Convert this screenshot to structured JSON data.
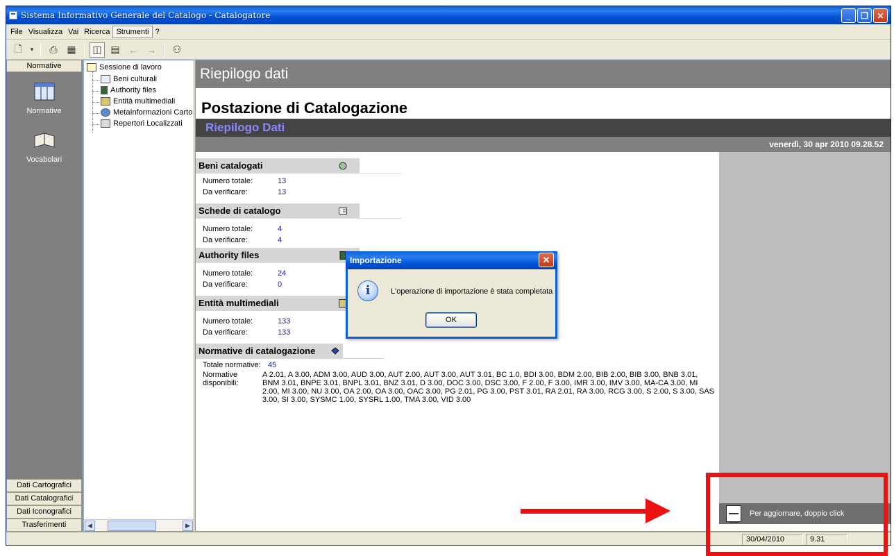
{
  "window": {
    "title": "Sistema Informativo Generale del Catalogo - Catalogatore"
  },
  "menu": {
    "items": [
      {
        "label": "File"
      },
      {
        "label": "Visualizza"
      },
      {
        "label": "Vai"
      },
      {
        "label": "Ricerca"
      },
      {
        "label": "Strumenti"
      },
      {
        "label": "?"
      }
    ]
  },
  "left_pane": {
    "header": "Normative",
    "items": [
      {
        "label": "Normative",
        "icon": "normative-icon"
      },
      {
        "label": "Vocabolari",
        "icon": "book-icon"
      }
    ],
    "bottom_buttons": [
      {
        "label": "Dati Cartografici"
      },
      {
        "label": "Dati Catalografici"
      },
      {
        "label": "Dati Iconografici"
      },
      {
        "label": "Trasferimenti"
      }
    ]
  },
  "tree": {
    "root": "Sessione di lavoro",
    "children": [
      {
        "label": "Beni culturali"
      },
      {
        "label": "Authority files"
      },
      {
        "label": "Entità multimediali"
      },
      {
        "label": "MetaInformazioni Carto"
      },
      {
        "label": "Repertori Localizzati"
      }
    ]
  },
  "content": {
    "header": "Riepilogo dati",
    "title": "Postazione di Catalogazione",
    "subtitle": "Riepilogo Dati",
    "date": "venerdì, 30 apr 2010 09.28.52",
    "sections": [
      {
        "title": "Beni catalogati",
        "icon": "beni-icon",
        "rows": [
          {
            "label": "Numero totale:",
            "value": "13"
          },
          {
            "label": "Da verificare:",
            "value": "13"
          }
        ]
      },
      {
        "title": "Schede di catalogo",
        "icon": "scheda-icon",
        "rows": [
          {
            "label": "Numero totale:",
            "value": "4"
          },
          {
            "label": "Da verificare:",
            "value": "4"
          }
        ]
      },
      {
        "title": "Authority files",
        "icon": "authority-icon",
        "rows": [
          {
            "label": "Numero totale:",
            "value": "24"
          },
          {
            "label": "Da verificare:",
            "value": "0"
          }
        ]
      },
      {
        "title": "Entità multimediali",
        "icon": "multimedia-icon",
        "rows": [
          {
            "label": "Numero totale:",
            "value": "133"
          },
          {
            "label": "Da verificare:",
            "value": "133"
          }
        ]
      },
      {
        "title": "Normative di catalogazione",
        "icon": "normative-book-icon",
        "rows": [
          {
            "label": "Totale normative:",
            "value": "45"
          }
        ]
      }
    ],
    "normative_disponibili_label": "Normative disponibili:",
    "normative_disponibili": "A 2.01, A 3.00, ADM 3.00, AUD 3.00, AUT 2.00, AUT 3.00, AUT 3.01, BC 1.0, BDI 3.00, BDM 2.00, BIB 2.00, BIB 3.00, BNB 3.01, BNM 3.01, BNPE 3.01, BNPL 3.01, BNZ 3.01, D 3.00, DOC 3.00, DSC 3.00, F 2.00, F 3.00, IMR 3.00, IMV 3.00, MA-CA 3.00, MI 2.00, MI 3.00, NU 3.00, OA 2.00, OA 3.00, OAC 3.00, PG 2.01, PG 3.00, PST 3.01, RA 2.01, RA 3.00, RCG 3.00, S 2.00, S 3.00, SAS 3.00, SI 3.00, SYSMC 1.00, SYSRL 1.00, TMA 3.00, VID 3.00",
    "footer_hint": "Per aggiornare, doppio click"
  },
  "dialog": {
    "title": "Importazione",
    "message": "L'operazione di importazione è stata completata",
    "ok_label": "OK"
  },
  "statusbar": {
    "date": "30/04/2010",
    "time": "9.31"
  },
  "colors": {
    "annotation": "#ee1111",
    "titlebar": "#0053d6",
    "subtitle": "#8a88ff"
  }
}
